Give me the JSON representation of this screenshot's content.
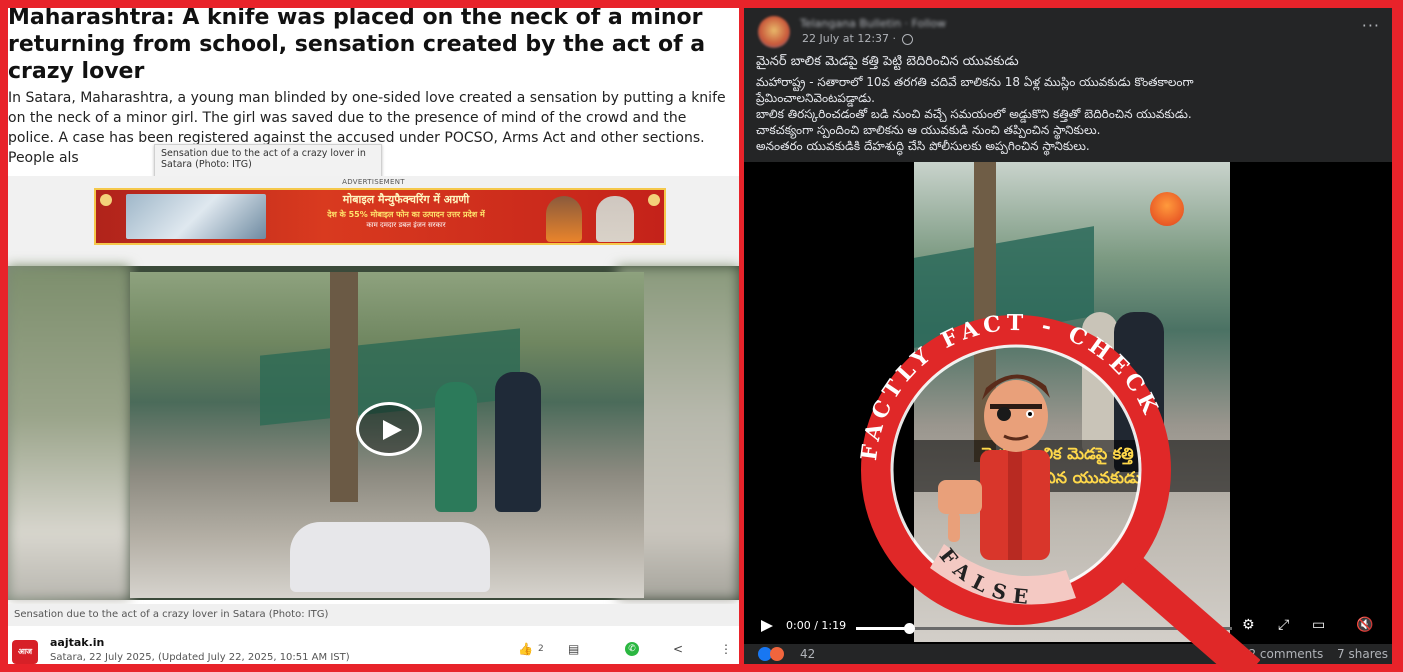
{
  "article": {
    "headline": "Maharashtra: A knife was placed on the neck of a minor returning from school, sensation created by the act of a crazy lover",
    "summary": "In Satara, Maharashtra, a young man blinded by one-sided love created a sensation by putting a knife on the neck of a minor girl. The girl was saved due to the presence of mind of the crowd and the police. A case has been registered against the accused under POCSO, Arms Act and other sections. People als",
    "tooltip": "Sensation due to the act of a crazy lover in Satara (Photo: ITG)",
    "ad_label": "ADVERTISEMENT",
    "ad_title": "मोबाइल मैन्युफैक्चरिंग में अग्रणी",
    "ad_subtitle": "देश के 55% मोबाइल फोन का उत्पादन उत्तर प्रदेश में",
    "ad_subtitle2": "काम दमदार  डबल इंजन सरकार",
    "video_caption": "Sensation due to the act of a crazy lover in Satara (Photo: ITG)",
    "source_logo": "आज तक",
    "source_name": "aajtak.in",
    "source_date": "Satara, 22 July 2025, (Updated July 22, 2025, 10:51 AM IST)",
    "like_count": "2"
  },
  "post": {
    "author": "Telangana Bulletin · Follow",
    "date": "22 July at 12:37 ·",
    "more": "···",
    "title": "మైనర్ బాలిక మెడపై కత్తి పెట్టి బెదిరించిన యువకుడు",
    "lines": [
      "మహారాష్ట్ర - సతారాలో 10వ తరగతి చదివే బాలికను 18 ఏళ్ల ముస్లిం యువకుడు కొంతకాలంగా",
      "ప్రేమించాలనివెంటపడ్డాడు.",
      "బాలిక తిరస్కరించడంతో బడి నుంచి వచ్చే సమయంలో అడ్డుకొని కత్తితో బెదిరించిన యువకుడు.",
      "చాకచక్యంగా స్పందించి బాలికను ఆ యువకుడి నుంచి తప్పించిన స్థానికులు.",
      "అనంతరం యువకుడికి దేహశుద్ధి చేసి పోలీసులకు అప్పగించిన స్థానికులు."
    ],
    "video_subtitle_1": "మైనర్ బాలిక మెడపై కత్తి పెట్టి",
    "video_subtitle_2": "బెదిరించిన యువకుడు",
    "time": "0:00 / 1:19",
    "progress": 0.14,
    "reactions_count": "42",
    "comments": "2 comments",
    "shares": "7 shares"
  },
  "stamp": {
    "arc_text": "FACTLY FACT - CHECK",
    "verdict": "FALSE"
  },
  "colors": {
    "background": "#e8232a",
    "fb_dark": "#242526",
    "stamp_red": "#e02828",
    "verdict_bg": "#f4c9c3"
  }
}
